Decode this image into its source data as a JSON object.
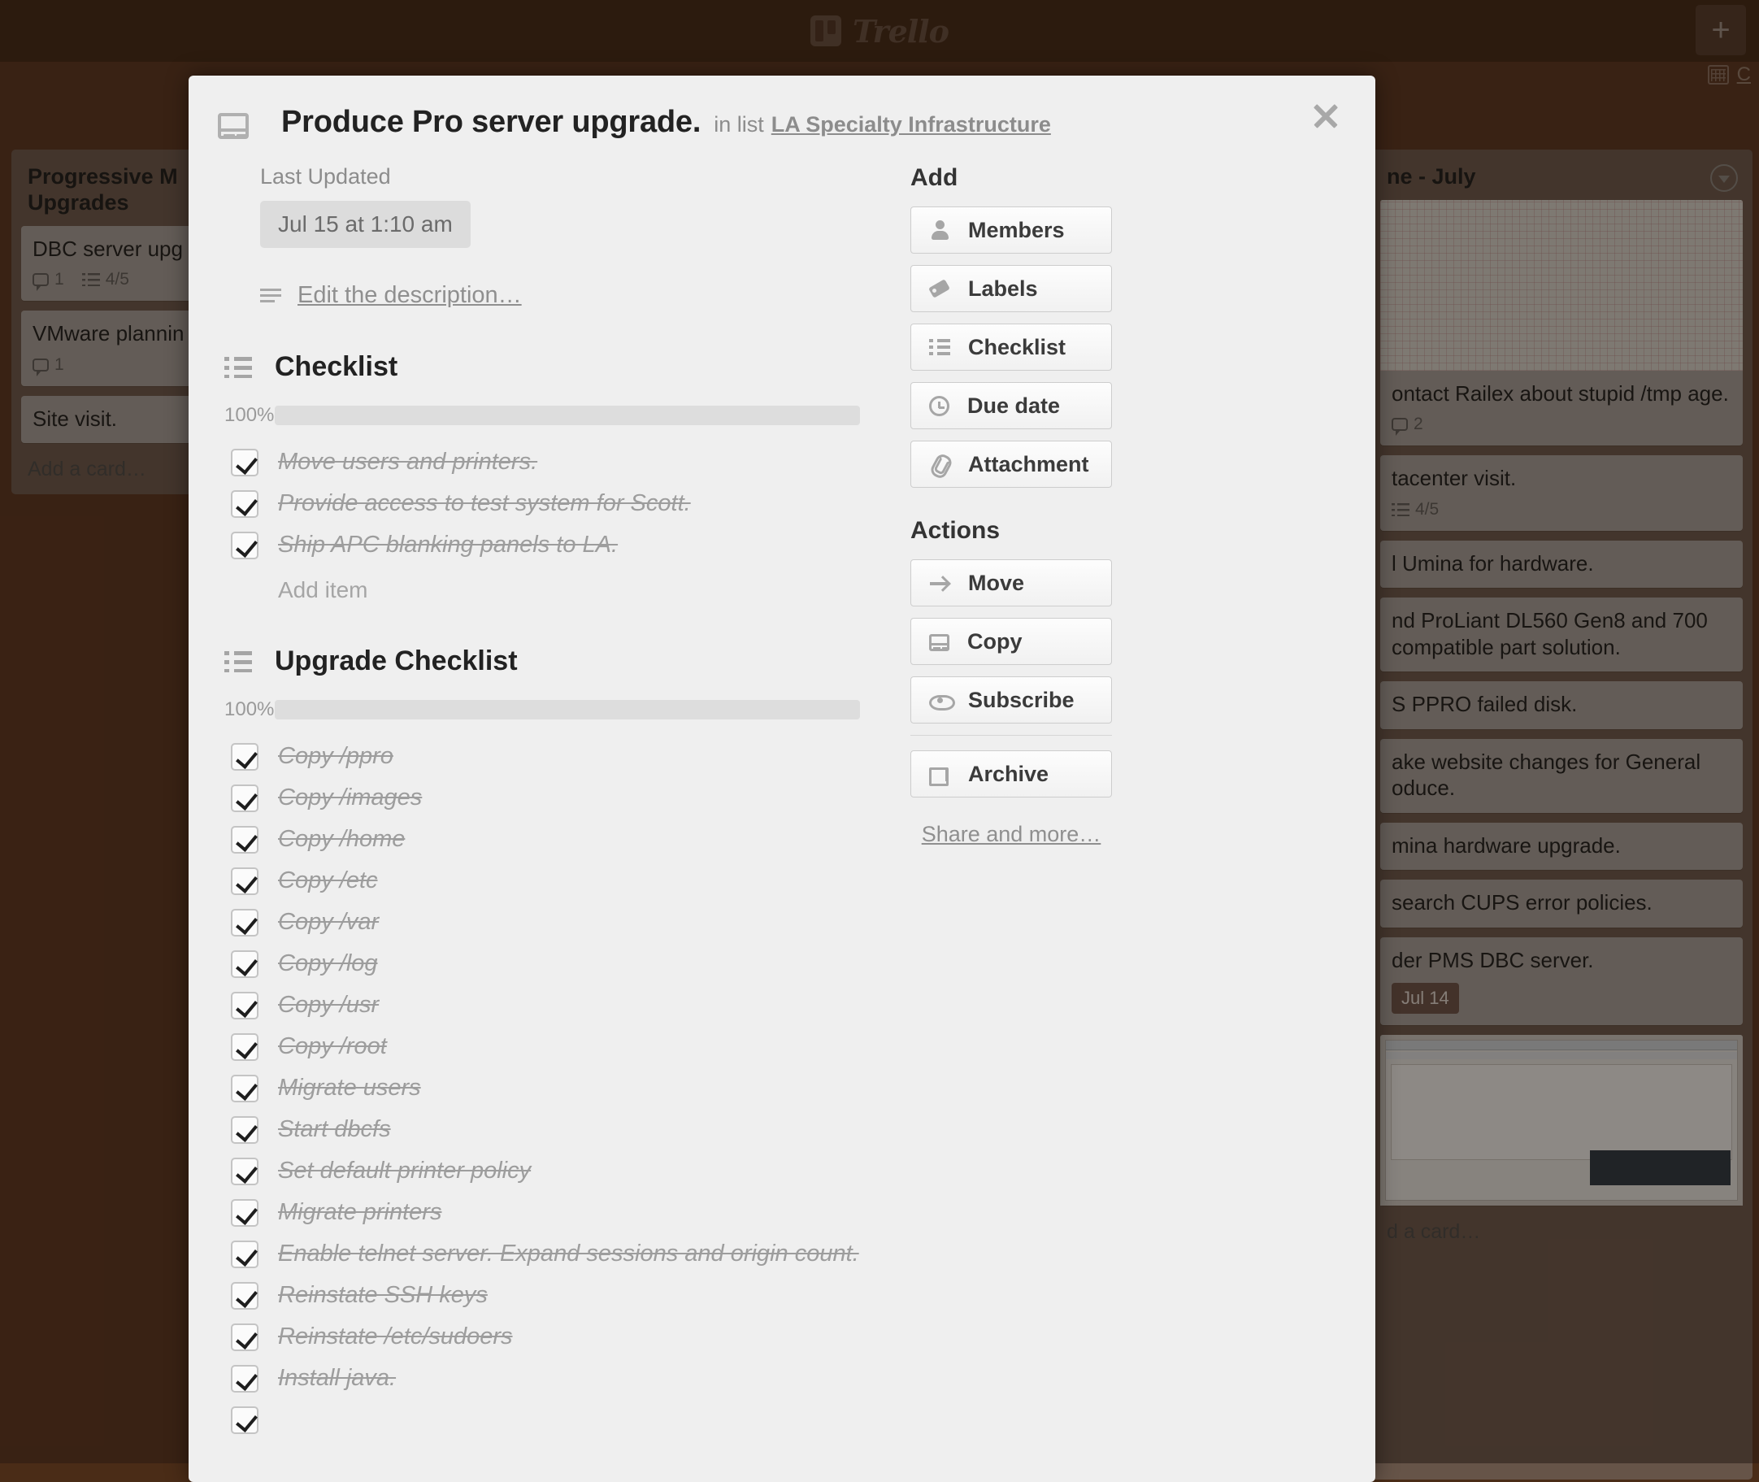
{
  "top_bar": {
    "logo_text": "Trello",
    "logo_icon": "trello-board-logo",
    "add_button_label": "+",
    "calendar_icon": "calendar-icon",
    "board_menu_text": "C"
  },
  "board": {
    "left_list": {
      "title": "Progressive M                 Upgrades",
      "title_line1": "Progressive M",
      "title_line2": "Upgrades",
      "add_card_label": "Add a card…",
      "cards": [
        {
          "title": "DBC server upg",
          "comments": "1",
          "checklist": "4/5"
        },
        {
          "title": "VMware plannin",
          "comments": "1",
          "checklist": ""
        },
        {
          "title": "Site visit.",
          "comments": "",
          "checklist": ""
        }
      ]
    },
    "right_list": {
      "title": "ne - July",
      "collapse_icon": "chevron-down-circle-icon",
      "add_card_label": "d a card…",
      "cards": [
        {
          "title": "ontact Railex about stupid /tmp age.",
          "badge": "2",
          "cover": "chart"
        },
        {
          "title": "tacenter visit.",
          "badge": "4/5",
          "cover": ""
        },
        {
          "title": "l Umina for hardware.",
          "badge": "",
          "cover": ""
        },
        {
          "title": "nd ProLiant DL560 Gen8 and 700 compatible part solution.",
          "badge": "",
          "cover": ""
        },
        {
          "title": "S PPRO failed disk.",
          "badge": "",
          "cover": ""
        },
        {
          "title": "ake website changes for General oduce.",
          "badge": "",
          "cover": ""
        },
        {
          "title": "mina hardware upgrade.",
          "badge": "",
          "cover": ""
        },
        {
          "title": "search CUPS error policies.",
          "badge": "",
          "cover": ""
        },
        {
          "title": "der PMS DBC server.",
          "badge": "",
          "due": "Jul 14",
          "cover": ""
        },
        {
          "title": "",
          "badge": "",
          "cover": "screenshot"
        }
      ]
    }
  },
  "card": {
    "icon": "card-window-icon",
    "close_icon": "close-icon",
    "title": "Produce Pro server upgrade.",
    "in_list_label": "in list",
    "list_name": "LA Specialty Infrastructure",
    "last_updated_label": "Last Updated",
    "last_updated_value": "Jul 15 at 1:10 am",
    "edit_description_label": "Edit the description…",
    "description_icon": "description-lines-icon",
    "checklists": [
      {
        "name": "Checklist",
        "icon": "checklist-icon",
        "percent": "100%",
        "percent_value": 100,
        "add_item_label": "Add item",
        "items": [
          {
            "label": "Move users and printers.",
            "checked": true
          },
          {
            "label": "Provide access to test system for Scott.",
            "checked": true
          },
          {
            "label": "Ship APC blanking panels to LA.",
            "checked": true
          }
        ]
      },
      {
        "name": "Upgrade Checklist",
        "icon": "checklist-icon",
        "percent": "100%",
        "percent_value": 100,
        "add_item_label": "",
        "items": [
          {
            "label": "Copy /ppro",
            "checked": true
          },
          {
            "label": "Copy /images",
            "checked": true
          },
          {
            "label": "Copy /home",
            "checked": true
          },
          {
            "label": "Copy /etc",
            "checked": true
          },
          {
            "label": "Copy /var",
            "checked": true
          },
          {
            "label": "Copy /log",
            "checked": true
          },
          {
            "label": "Copy /usr",
            "checked": true
          },
          {
            "label": "Copy /root",
            "checked": true
          },
          {
            "label": "Migrate users",
            "checked": true
          },
          {
            "label": "Start dbcfs",
            "checked": true
          },
          {
            "label": "Set default printer policy",
            "checked": true
          },
          {
            "label": "Migrate printers",
            "checked": true
          },
          {
            "label": "Enable telnet server. Expand sessions and origin count.",
            "checked": true
          },
          {
            "label": "Reinstate SSH keys",
            "checked": true
          },
          {
            "label": "Reinstate /etc/sudoers",
            "checked": true
          },
          {
            "label": "Install java.",
            "checked": true
          }
        ]
      }
    ],
    "sidebar": {
      "add_heading": "Add",
      "add_buttons": [
        {
          "label": "Members",
          "icon": "member-icon"
        },
        {
          "label": "Labels",
          "icon": "label-tag-icon"
        },
        {
          "label": "Checklist",
          "icon": "checklist-icon"
        },
        {
          "label": "Due date",
          "icon": "clock-icon"
        },
        {
          "label": "Attachment",
          "icon": "paperclip-icon"
        }
      ],
      "actions_heading": "Actions",
      "action_buttons": [
        {
          "label": "Move",
          "icon": "arrow-right-icon"
        },
        {
          "label": "Copy",
          "icon": "copy-card-icon"
        },
        {
          "label": "Subscribe",
          "icon": "eye-icon"
        }
      ],
      "archive_button": {
        "label": "Archive",
        "icon": "archive-box-icon"
      },
      "share_link": "Share and more…"
    }
  },
  "colors": {
    "board_bg": "#5a3520",
    "modal_bg": "#efefef",
    "progress_blue": "#3e95cd",
    "muted_text": "#9d9d9d"
  }
}
